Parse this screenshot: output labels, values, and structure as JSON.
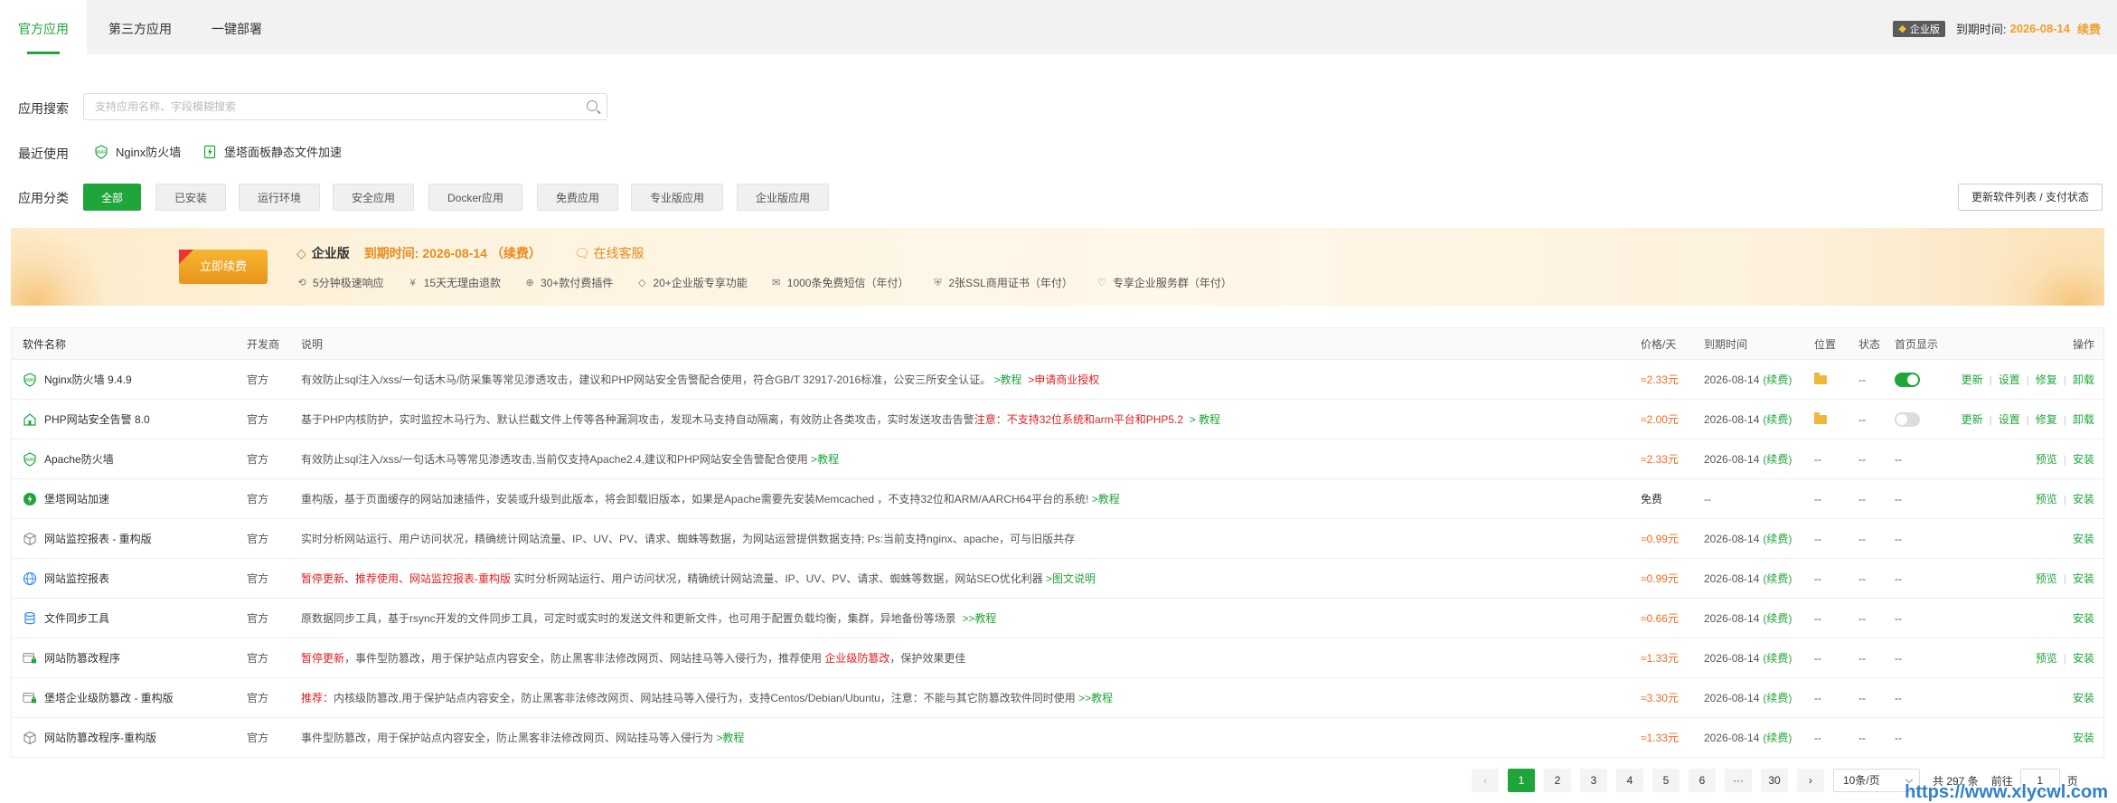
{
  "tabs": [
    {
      "label": "官方应用",
      "active": true
    },
    {
      "label": "第三方应用",
      "active": false
    },
    {
      "label": "一键部署",
      "active": false
    }
  ],
  "header": {
    "badge": "企业版",
    "expire_label": "到期时间:",
    "expire_date": "2026-08-14",
    "renew": "续费"
  },
  "search": {
    "label": "应用搜索",
    "placeholder": "支持应用名称、字段模糊搜索"
  },
  "recent": {
    "label": "最近使用",
    "items": [
      {
        "label": "Nginx防火墙",
        "icon": "firewall-icon"
      },
      {
        "label": "堡塔面板静态文件加速",
        "icon": "lightning-icon"
      }
    ]
  },
  "categories": {
    "label": "应用分类",
    "items": [
      "全部",
      "已安装",
      "运行环境",
      "安全应用",
      "Docker应用",
      "免费应用",
      "专业版应用",
      "企业版应用"
    ],
    "active": "全部"
  },
  "update_button": "更新软件列表 / 支付状态",
  "banner": {
    "renew_button": "立即续费",
    "edition": "企业版",
    "expire": "到期时间: 2026-08-14 （续费）",
    "service": "在线客服",
    "features": [
      "5分钟极速响应",
      "15天无理由退款",
      "30+款付费插件",
      "20+企业版专享功能",
      "1000条免费短信（年付）",
      "2张SSL商用证书（年付）",
      "专享企业服务群（年付）"
    ]
  },
  "table": {
    "headers": {
      "name": "软件名称",
      "dev": "开发商",
      "desc": "说明",
      "price": "价格/天",
      "expire": "到期时间",
      "pos": "位置",
      "status": "状态",
      "home": "首页显示",
      "ops": "操作"
    },
    "rows": [
      {
        "name": "Nginx防火墙 9.4.9",
        "icon": "firewall-icon",
        "dev": "官方",
        "desc": [
          {
            "t": "有效防止sql注入/xss/一句话木马/防采集等常见渗透攻击，建议和PHP网站安全告警配合使用，符合GB/T 32917-2016标准，公安三所安全认证。 "
          },
          {
            "t": ">教程",
            "c": "green"
          },
          {
            "t": "  "
          },
          {
            "t": ">申请商业授权",
            "c": "red"
          }
        ],
        "price": "≈2.33元",
        "expire": "2026-08-14",
        "renew": "(续费)",
        "pos": "folder",
        "status": "--",
        "home": "on",
        "ops": [
          "更新",
          "设置",
          "修复",
          "卸载"
        ]
      },
      {
        "name": "PHP网站安全告警 8.0",
        "icon": "house-icon",
        "dev": "官方",
        "desc": [
          {
            "t": "基于PHP内核防护，实时监控木马行为、默认拦截文件上传等各种漏洞攻击，发现木马支持自动隔离，有效防止各类攻击，实时发送攻击告警"
          },
          {
            "t": "注意：不支持32位系统和arm平台和PHP5.2",
            "c": "red"
          },
          {
            "t": "  "
          },
          {
            "t": "> 教程",
            "c": "green"
          }
        ],
        "price": "≈2.00元",
        "expire": "2026-08-14",
        "renew": "(续费)",
        "pos": "folder",
        "status": "--",
        "home": "off",
        "ops": [
          "更新",
          "设置",
          "修复",
          "卸载"
        ]
      },
      {
        "name": "Apache防火墙",
        "icon": "firewall-icon",
        "dev": "官方",
        "desc": [
          {
            "t": "有效防止sql注入/xss/一句话木马等常见渗透攻击,当前仅支持Apache2.4,建议和PHP网站安全告警配合使用 "
          },
          {
            "t": ">教程",
            "c": "green"
          }
        ],
        "price": "≈2.33元",
        "expire": "2026-08-14",
        "renew": "(续费)",
        "pos": "--",
        "status": "--",
        "home": "--",
        "ops": [
          "预览",
          "安装"
        ]
      },
      {
        "name": "堡塔网站加速",
        "icon": "lightning-icon",
        "dev": "官方",
        "desc": [
          {
            "t": "重构版，基于页面缓存的网站加速插件，安装或升级到此版本，将会卸载旧版本，如果是Apache需要先安装Memcached ，不支持32位和ARM/AARCH64平台的系统! "
          },
          {
            "t": ">教程",
            "c": "green"
          }
        ],
        "price": "免费",
        "free": true,
        "expire": "--",
        "renew": "",
        "pos": "--",
        "status": "--",
        "home": "--",
        "ops": [
          "预览",
          "安装"
        ]
      },
      {
        "name": "网站监控报表 - 重构版",
        "icon": "cube-icon",
        "dev": "官方",
        "desc": [
          {
            "t": "实时分析网站运行、用户访问状况，精确统计网站流量、IP、UV、PV、请求、蜘蛛等数据，为网站运营提供数据支持; Ps:当前支持nginx、apache，可与旧版共存"
          }
        ],
        "price": "≈0.99元",
        "expire": "2026-08-14",
        "renew": "(续费)",
        "pos": "--",
        "status": "--",
        "home": "--",
        "ops": [
          "安装"
        ]
      },
      {
        "name": "网站监控报表",
        "icon": "globe-icon",
        "dev": "官方",
        "desc": [
          {
            "t": "暂停更新、推荐使用、网站监控报表-重构版",
            "c": "red"
          },
          {
            "t": " 实时分析网站运行、用户访问状况，精确统计网站流量、IP、UV、PV、请求、蜘蛛等数据，网站SEO优化利器 "
          },
          {
            "t": ">图文说明",
            "c": "green"
          }
        ],
        "price": "≈0.99元",
        "expire": "2026-08-14",
        "renew": "(续费)",
        "pos": "--",
        "status": "--",
        "home": "--",
        "ops": [
          "预览",
          "安装"
        ]
      },
      {
        "name": "文件同步工具",
        "icon": "database-icon",
        "dev": "官方",
        "desc": [
          {
            "t": "原数据同步工具，基于rsync开发的文件同步工具，可定时或实时的发送文件和更新文件，也可用于配置负载均衡，集群，异地备份等场景  "
          },
          {
            "t": ">>教程",
            "c": "green"
          }
        ],
        "price": "≈0.66元",
        "expire": "2026-08-14",
        "renew": "(续费)",
        "pos": "--",
        "status": "--",
        "home": "--",
        "ops": [
          "安装"
        ]
      },
      {
        "name": "网站防篡改程序",
        "icon": "lock-page-icon",
        "dev": "官方",
        "desc": [
          {
            "t": "暂停更新",
            "c": "red"
          },
          {
            "t": "，事件型防篡改，用于保护站点内容安全，防止黑客非法修改网页、网站挂马等入侵行为，推荐使用 "
          },
          {
            "t": "企业级防篡改",
            "c": "red"
          },
          {
            "t": "，保护效果更佳"
          }
        ],
        "price": "≈1.33元",
        "expire": "2026-08-14",
        "renew": "(续费)",
        "pos": "--",
        "status": "--",
        "home": "--",
        "ops": [
          "预览",
          "安装"
        ]
      },
      {
        "name": "堡塔企业级防篡改 - 重构版",
        "icon": "lock-page-icon",
        "dev": "官方",
        "desc": [
          {
            "t": "推荐：",
            "c": "red"
          },
          {
            "t": "内核级防篡改,用于保护站点内容安全，防止黑客非法修改网页、网站挂马等入侵行为，支持Centos/Debian/Ubuntu，注意：不能与其它防篡改软件同时使用 "
          },
          {
            "t": ">>教程",
            "c": "green"
          }
        ],
        "price": "≈3.30元",
        "expire": "2026-08-14",
        "renew": "(续费)",
        "pos": "--",
        "status": "--",
        "home": "--",
        "ops": [
          "安装"
        ]
      },
      {
        "name": "网站防篡改程序-重构版",
        "icon": "cube-icon",
        "dev": "官方",
        "desc": [
          {
            "t": "事件型防篡改，用于保护站点内容安全，防止黑客非法修改网页、网站挂马等入侵行为 "
          },
          {
            "t": ">教程",
            "c": "green"
          }
        ],
        "price": "≈1.33元",
        "expire": "2026-08-14",
        "renew": "(续费)",
        "pos": "--",
        "status": "--",
        "home": "--",
        "ops": [
          "安装"
        ]
      }
    ]
  },
  "pagination": {
    "pages": [
      "1",
      "2",
      "3",
      "4",
      "5",
      "6",
      "···",
      "30"
    ],
    "active": "1",
    "prev": "‹",
    "next": "›",
    "per_page": "10条/页",
    "total": "共 297 条",
    "goto_label": "前往",
    "goto_value": "1",
    "page_suffix": "页"
  },
  "watermark": "https://www.xlycwl.com",
  "colors": {
    "accent": "#20a53a",
    "price": "#f26b24",
    "warning": "#e02020",
    "gold": "#f0a12b"
  }
}
